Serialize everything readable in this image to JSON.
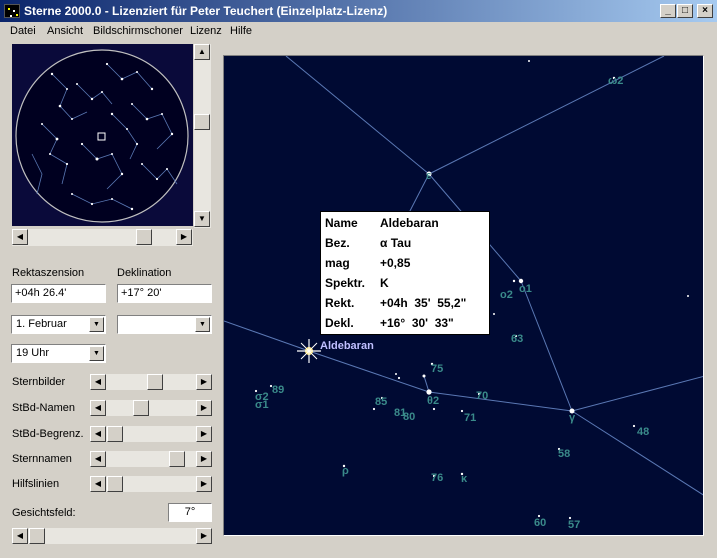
{
  "window": {
    "title": "Sterne 2000.0 - Lizenziert für Peter Teuchert (Einzelplatz-Lizenz)",
    "minimize_glyph": "_",
    "maximize_glyph": "□",
    "close_glyph": "×"
  },
  "menu": {
    "datei": "Datei",
    "ansicht": "Ansicht",
    "bildschirmschoner": "Bildschirmschoner",
    "lizenz": "Lizenz",
    "hilfe": "Hilfe"
  },
  "coords": {
    "ra_label": "Rektaszension",
    "dec_label": "Deklination",
    "ra_value": "+04h 26.4'",
    "dec_value": "+17° 20'"
  },
  "date": {
    "selected": "1. Februar",
    "second": ""
  },
  "time": {
    "selected": "19 Uhr"
  },
  "sliders": {
    "sternbilder": "Sternbilder",
    "stbd_namen": "StBd-Namen",
    "stbd_begrenz": "StBd-Begrenz.",
    "sternnamen": "Sternnamen",
    "hilfslinien": "Hilfslinien"
  },
  "slider_levels": {
    "sternbilder": 0.55,
    "stbd_namen": 0.35,
    "stbd_begrenz": 0.0,
    "sternnamen": 0.85,
    "hilfslinien": 0.0
  },
  "fov": {
    "label": "Gesichtsfeld:",
    "value": "7°"
  },
  "star_info": {
    "name_key": "Name",
    "name_val": "Aldebaran",
    "bez_key": "Bez.",
    "bez_val": "α Tau",
    "mag_key": "mag",
    "mag_val": "+0,85",
    "spektr_key": "Spektr.",
    "spektr_val": "K",
    "rekt_key": "Rekt.",
    "rekt_val": "+04h  35'  55,2\"",
    "dekl_key": "Dekl.",
    "dekl_val": "+16°  30'  33\""
  },
  "sky_labels": {
    "aldebaran": "Aldebaran",
    "s_epsilon": "ε",
    "s_omega2": "ω2",
    "s_o2": "o2",
    "s_o1": "o1",
    "s_63": "63",
    "s_75": "75",
    "s_89": "89",
    "s_sigma2": "σ2",
    "s_sigma1": "σ1",
    "s_85": "85",
    "s_81": "81",
    "s_80": "80",
    "s_82": "θ2",
    "s_70": "70",
    "s_71": "71",
    "s_gamma": "γ",
    "s_48": "48",
    "s_58": "58",
    "s_rho": "ρ",
    "s_76": "76",
    "s_kappa": "κ",
    "s_60": "60",
    "s_57": "57"
  },
  "colors": {
    "sky": "#000a33",
    "constellation_line": "#5a78b4",
    "star_label": "#3a8a8a",
    "highlight_label": "#c0c0ff"
  }
}
